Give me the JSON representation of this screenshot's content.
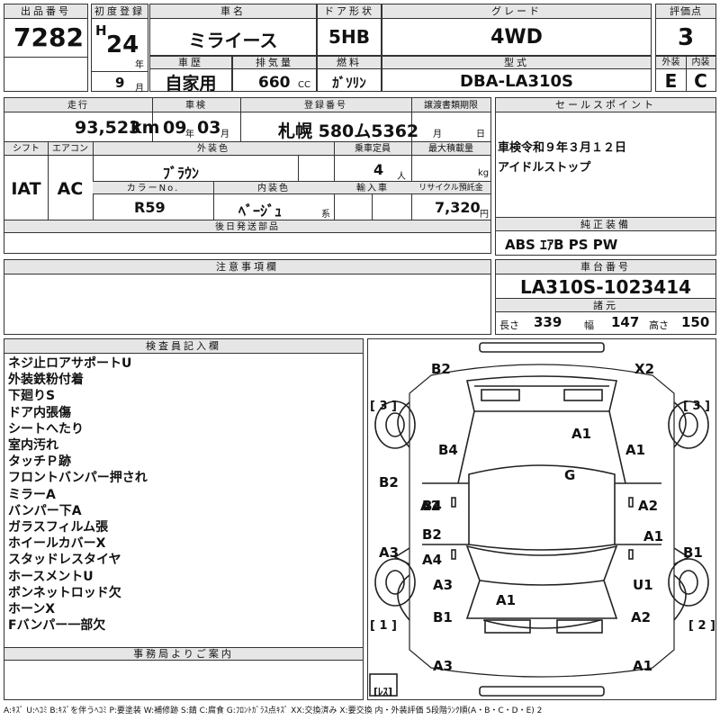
{
  "header": {
    "lot_label": "出品番号",
    "lot_no": "7282",
    "first_reg_label": "初度登録",
    "era": "H",
    "first_reg_year": "24",
    "year_unit": "年",
    "first_reg_month": "9",
    "month_unit": "月",
    "car_name_label": "車名",
    "car_name": "ミライース",
    "door_label": "ドア形状",
    "door": "5HB",
    "grade_label": "グレード",
    "grade": "4WD",
    "score_label": "評価点",
    "score": "3",
    "history_label": "車歴",
    "history": "自家用",
    "displacement_label": "排気量",
    "displacement": "660",
    "displacement_unit": "CC",
    "fuel_label": "燃料",
    "fuel": "ｶﾞｿﾘﾝ",
    "model_label": "型式",
    "model": "DBA-LA310S",
    "exterior_label": "外装",
    "exterior": "E",
    "interior_label": "内装",
    "interior": "C"
  },
  "details": {
    "mileage_label": "走行",
    "mileage": "93,523",
    "mileage_unit": "km",
    "inspection_label": "車検",
    "insp_year": "09",
    "insp_year_unit": "年",
    "insp_month": "03",
    "insp_month_unit": "月",
    "reg_no_label": "登録番号",
    "reg_no": "札幌 580ム5362",
    "transfer_label": "譲渡書類期限",
    "transfer_month_unit": "月",
    "transfer_day_unit": "日",
    "sales_label": "セールスポイント",
    "sales_lines": [
      "車検令和９年３月１２日",
      "アイドルストップ"
    ],
    "shift_label": "シフト",
    "shift": "IAT",
    "ac_label": "エアコン",
    "ac": "AC",
    "ext_color_label": "外装色",
    "ext_color": "ﾌﾞﾗｳﾝ",
    "capacity_label": "乗車定員",
    "capacity": "4",
    "capacity_unit": "人",
    "max_load_label": "最大積載量",
    "max_load_unit": "kg",
    "color_no_label": "カラーNo.",
    "color_no": "R59",
    "int_color_label": "内装色",
    "int_color": "ﾍﾞｰｼﾞｭ",
    "int_color_unit": "系",
    "import_label": "輸入車",
    "recycle_label": "リサイクル預託金",
    "recycle": "7,320",
    "recycle_unit": "円",
    "later_parts_label": "後日発送部品",
    "genuine_label": "純正装備",
    "genuine": "ABS ｴｱB PS PW",
    "notice_label": "注意事項欄",
    "chassis_label": "車台番号",
    "chassis": "LA310S-1023414",
    "specs_label": "諸元",
    "length_label": "長さ",
    "length": "339",
    "width_label": "幅",
    "width": "147",
    "height_label": "高さ",
    "height": "150"
  },
  "inspector": {
    "label": "検査員記入欄",
    "notes": [
      "ネジ止ロアサポートU",
      "外装鉄粉付着",
      "下廻りS",
      "ドア内張傷",
      "シートへたり",
      "室内汚れ",
      "タッチＰ跡",
      "フロントバンパー押され",
      "ミラーA",
      "バンパー下A",
      "ガラスフィルム張",
      "ホイールカバーX",
      "スタッドレスタイヤ",
      "ホースメントU",
      "ボンネットロッド欠",
      "ホーンX",
      "Fバンパー一部欠"
    ]
  },
  "office": {
    "label": "事務局よりご案内"
  },
  "diagram": {
    "marks": [
      "B2",
      "X2",
      "A1",
      "B4",
      "A1",
      "B2",
      "G",
      "A2",
      "B4",
      "A2",
      "A3",
      "B2",
      "A1",
      "A4",
      "B1",
      "A3",
      "U1",
      "A1",
      "B1",
      "A2",
      "A3",
      "A1"
    ],
    "tire_labels": [
      "[ 3 ]",
      "[ 3 ]",
      "[ 1 ]",
      "[ 2 ]",
      "[ﾚｽ]"
    ]
  },
  "legend": "A:ｷｽﾞ U:ﾍｺﾐ B:ｷｽﾞを伴うﾍｺﾐ P:要塗装 W:補修跡 S:錆 C:腐食 G:ﾌﾛﾝﾄｶﾞﾗｽ点ｷｽﾞ XX:交換済み X:要交換 内・外装評価 5段階ﾗﾝｸ順(A・B・C・D・E) 2"
}
